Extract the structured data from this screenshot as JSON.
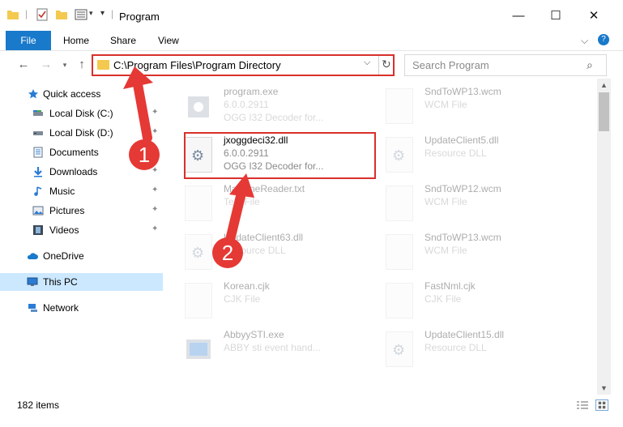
{
  "window": {
    "title": "Program",
    "minimize": "—",
    "maximize": "☐",
    "close": "✕"
  },
  "ribbon": {
    "file": "File",
    "home": "Home",
    "share": "Share",
    "view": "View",
    "expand": "⌵",
    "help": "?"
  },
  "address": {
    "path": "C:\\Program Files\\Program Directory",
    "dropdown": "⌵",
    "refresh": "↻"
  },
  "search": {
    "placeholder": "Search Program",
    "icon": "⌕"
  },
  "sidebar": {
    "items": [
      {
        "label": "Quick access",
        "icon": "star-icon"
      },
      {
        "label": "Local Disk (C:)",
        "icon": "drive-icon",
        "pinned": true
      },
      {
        "label": "Local Disk (D:)",
        "icon": "drive-icon",
        "pinned": true
      },
      {
        "label": "Documents",
        "icon": "documents-icon",
        "pinned": true
      },
      {
        "label": "Downloads",
        "icon": "downloads-icon",
        "pinned": true
      },
      {
        "label": "Music",
        "icon": "music-icon",
        "pinned": true
      },
      {
        "label": "Pictures",
        "icon": "pictures-icon",
        "pinned": true
      },
      {
        "label": "Videos",
        "icon": "videos-icon",
        "pinned": true
      },
      {
        "label": "OneDrive",
        "icon": "cloud-icon"
      },
      {
        "label": "This PC",
        "icon": "computer-icon",
        "selected": true
      },
      {
        "label": "Network",
        "icon": "network-icon"
      }
    ],
    "pin_glyph": "✦"
  },
  "files": {
    "left": [
      {
        "name": "program.exe",
        "line2": "6.0.0.2911",
        "line3": "OGG I32 Decoder for...",
        "faded": true
      },
      {
        "name": "jxoggdeci32.dll",
        "line2": "6.0.0.2911",
        "line3": "OGG I32 Decoder for...",
        "faded": false
      },
      {
        "name": "MachineReader.txt",
        "line2": "Text File",
        "line3": "",
        "faded": true
      },
      {
        "name": "UpdateClient63.dll",
        "line2": "Resource DLL",
        "line3": "",
        "faded": true
      },
      {
        "name": "Korean.cjk",
        "line2": "CJK File",
        "line3": "",
        "faded": true
      },
      {
        "name": "AbbyySTI.exe",
        "line2": "ABBY sti event hand...",
        "line3": "",
        "faded": true
      }
    ],
    "right": [
      {
        "name": "SndToWP13.wcm",
        "line2": "WCM File"
      },
      {
        "name": "UpdateClient5.dll",
        "line2": "Resource DLL"
      },
      {
        "name": "SndToWP12.wcm",
        "line2": "WCM File"
      },
      {
        "name": "SndToWP13.wcm",
        "line2": "WCM File"
      },
      {
        "name": "FastNml.cjk",
        "line2": "CJK File"
      },
      {
        "name": "UpdateClient15.dll",
        "line2": "Resource DLL"
      }
    ]
  },
  "status": {
    "count": "182 items"
  },
  "annotations": {
    "one": "1",
    "two": "2"
  },
  "colors": {
    "accent": "#1979ca",
    "highlight_border": "#d9302c",
    "annotation": "#e53935",
    "selected": "#cce8ff"
  }
}
